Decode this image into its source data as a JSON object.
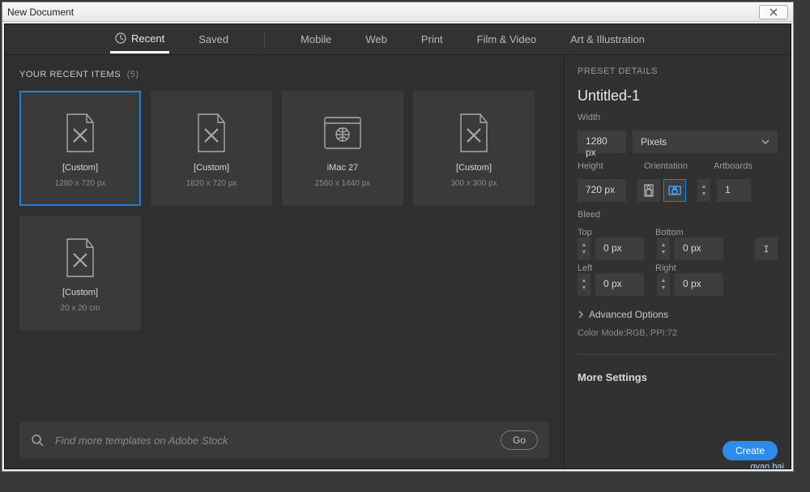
{
  "window": {
    "title": "New Document"
  },
  "tabs": {
    "recent": "Recent",
    "saved": "Saved",
    "mobile": "Mobile",
    "web": "Web",
    "print": "Print",
    "film": "Film & Video",
    "art": "Art & Illustration"
  },
  "section": {
    "title": "YOUR RECENT ITEMS",
    "count": "(5)"
  },
  "cards": [
    {
      "name": "[Custom]",
      "dims": "1280 x 720 px",
      "icon": "doc-x"
    },
    {
      "name": "[Custom]",
      "dims": "1820 x 720 px",
      "icon": "doc-x"
    },
    {
      "name": "iMac 27",
      "dims": "2560 x 1440 px",
      "icon": "web"
    },
    {
      "name": "[Custom]",
      "dims": "300 x 300 px",
      "icon": "doc-x"
    },
    {
      "name": "[Custom]",
      "dims": "20 x 20 cm",
      "icon": "doc-x"
    }
  ],
  "search": {
    "placeholder": "Find more templates on Adobe Stock",
    "go": "Go"
  },
  "details": {
    "hdr": "PRESET DETAILS",
    "name": "Untitled-1",
    "width_label": "Width",
    "width": "1280 px",
    "units": "Pixels",
    "height_label": "Height",
    "height": "720 px",
    "orientation_label": "Orientation",
    "artboards_label": "Artboards",
    "artboards": "1",
    "bleed_label": "Bleed",
    "top_label": "Top",
    "bottom_label": "Bottom",
    "left_label": "Left",
    "right_label": "Right",
    "bleed_val": "0 px",
    "advanced": "Advanced Options",
    "meta": "Color Mode:RGB, PPI:72",
    "more": "More Settings",
    "create": "Create"
  },
  "watermark": "gyan.bai"
}
